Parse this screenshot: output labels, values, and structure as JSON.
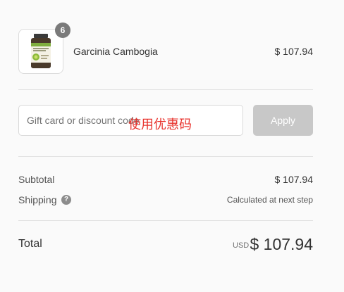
{
  "order_summary": {
    "product": {
      "name": "Garcinia Cambogia",
      "price": "$ 107.94",
      "quantity": "6",
      "image_icon": "supplement-bottle-icon"
    },
    "discount": {
      "placeholder": "Gift card or discount code",
      "value": "",
      "apply_label": "Apply",
      "annotation": "使用优惠码"
    },
    "subtotal": {
      "label": "Subtotal",
      "value": "$ 107.94"
    },
    "shipping": {
      "label": "Shipping",
      "value": "Calculated at next step",
      "help_icon": "question-circle-icon",
      "help_glyph": "?"
    },
    "total": {
      "label": "Total",
      "currency": "USD",
      "amount": "$ 107.94"
    }
  },
  "colors": {
    "background": "#fafafa",
    "apply_button": "#c8c8c8",
    "badge": "#7a7a7a",
    "annotation": "#e8322c"
  }
}
